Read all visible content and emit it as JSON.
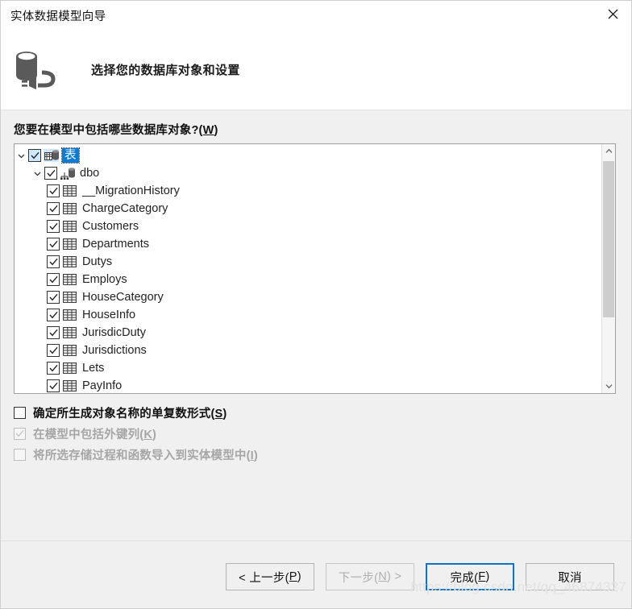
{
  "window": {
    "title": "实体数据模型向导",
    "close_icon": "close-icon"
  },
  "header": {
    "icon": "database-connection-icon",
    "title": "选择您的数据库对象和设置"
  },
  "main": {
    "question_label_prefix": "您要在模型中包括哪些数据库对象?(",
    "question_label_accel": "W",
    "question_label_suffix": ")",
    "tree": {
      "root": {
        "label": "表",
        "icon": "database-tables-icon",
        "checked": true,
        "expanded": true,
        "selected": true
      },
      "schema": {
        "label": "dbo",
        "icon": "schema-icon",
        "checked": true,
        "expanded": true
      },
      "tables": [
        {
          "label": "__MigrationHistory",
          "icon": "table-icon",
          "checked": true
        },
        {
          "label": "ChargeCategory",
          "icon": "table-icon",
          "checked": true
        },
        {
          "label": "Customers",
          "icon": "table-icon",
          "checked": true
        },
        {
          "label": "Departments",
          "icon": "table-icon",
          "checked": true
        },
        {
          "label": "Dutys",
          "icon": "table-icon",
          "checked": true
        },
        {
          "label": "Employs",
          "icon": "table-icon",
          "checked": true
        },
        {
          "label": "HouseCategory",
          "icon": "table-icon",
          "checked": true
        },
        {
          "label": "HouseInfo",
          "icon": "table-icon",
          "checked": true
        },
        {
          "label": "JurisdicDuty",
          "icon": "table-icon",
          "checked": true
        },
        {
          "label": "Jurisdictions",
          "icon": "table-icon",
          "checked": true
        },
        {
          "label": "Lets",
          "icon": "table-icon",
          "checked": true
        },
        {
          "label": "PayInfo",
          "icon": "table-icon",
          "checked": true
        }
      ]
    },
    "options": [
      {
        "prefix": "确定所生成对象名称的单复数形式(",
        "accel": "S",
        "suffix": ")",
        "checked": false,
        "disabled": false
      },
      {
        "prefix": "在模型中包括外键列(",
        "accel": "K",
        "suffix": ")",
        "checked": true,
        "disabled": true
      },
      {
        "prefix": "将所选存储过程和函数导入到实体模型中(",
        "accel": "I",
        "suffix": ")",
        "checked": false,
        "disabled": true
      }
    ]
  },
  "footer": {
    "back_prefix": "< 上一步(",
    "back_accel": "P",
    "back_suffix": ")",
    "next_prefix": "下一步(",
    "next_accel": "N",
    "next_suffix": ") >",
    "finish_prefix": "完成(",
    "finish_accel": "F",
    "finish_suffix": ")",
    "cancel": "取消"
  },
  "watermark": "https://blog.csdn.net/qq_46874327",
  "colors": {
    "selection_blue": "#0a7cd6",
    "default_button_border": "#0a74c8",
    "tree_label_orange": "#c8761a",
    "window_bg": "#f0f0f0"
  }
}
